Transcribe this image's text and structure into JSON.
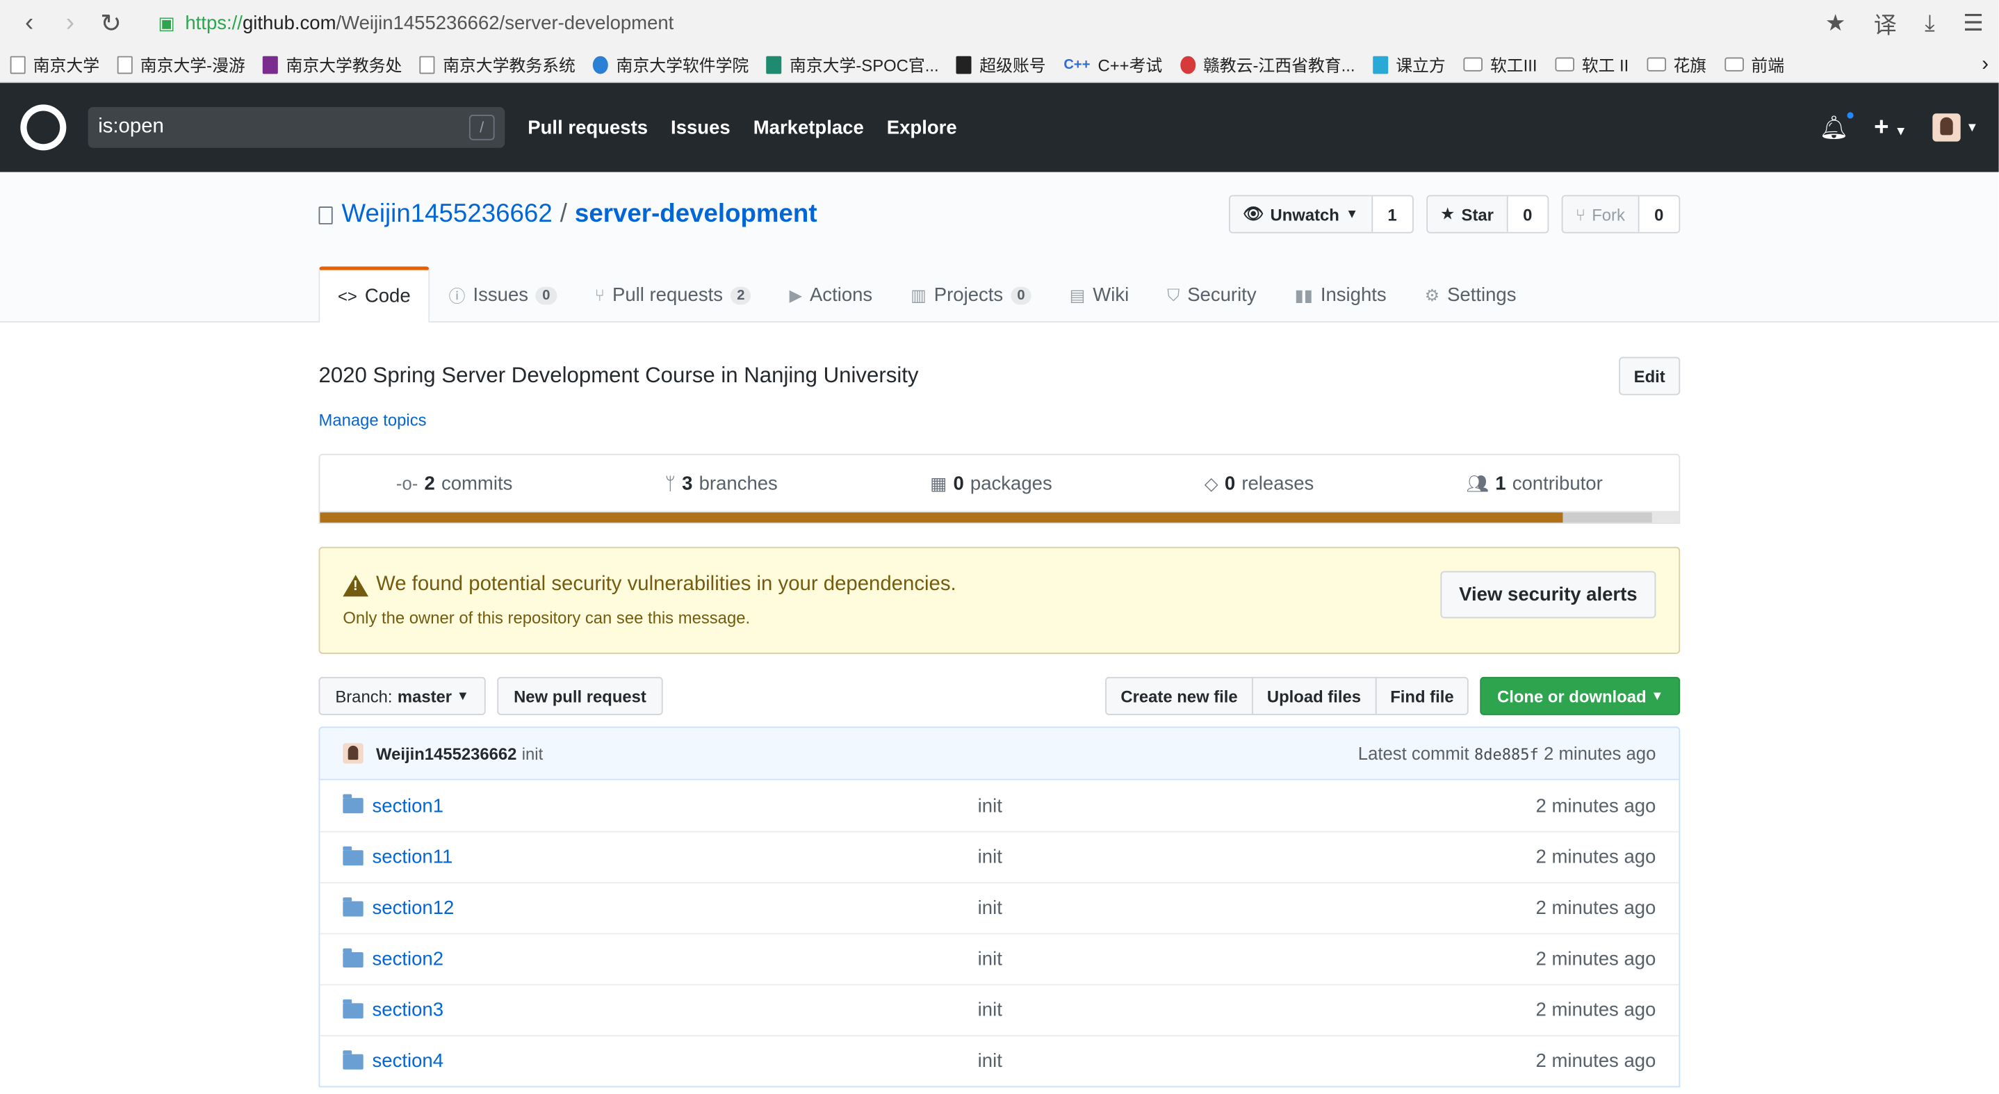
{
  "browser": {
    "url_scheme": "https://",
    "url_host": "github.com",
    "url_path": "/Weijin1455236662/server-development",
    "bookmarks": [
      {
        "label": "南京大学",
        "icon": "page"
      },
      {
        "label": "南京大学-漫游",
        "icon": "page"
      },
      {
        "label": "南京大学教务处",
        "icon": "seal"
      },
      {
        "label": "南京大学教务系统",
        "icon": "page"
      },
      {
        "label": "南京大学软件学院",
        "icon": "globe"
      },
      {
        "label": "南京大学-SPOC官...",
        "icon": "book"
      },
      {
        "label": "超级账号",
        "icon": "horse"
      },
      {
        "label": "C++考试",
        "icon": "cpp"
      },
      {
        "label": "赣教云-江西省教育...",
        "icon": "flag"
      },
      {
        "label": "课立方",
        "icon": "cube"
      },
      {
        "label": "软工III",
        "icon": "folder"
      },
      {
        "label": "软工 II",
        "icon": "folder"
      },
      {
        "label": "花旗",
        "icon": "folder"
      },
      {
        "label": "前端",
        "icon": "folder"
      }
    ]
  },
  "header": {
    "search_value": "is:open",
    "search_shortcut": "/",
    "nav": [
      "Pull requests",
      "Issues",
      "Marketplace",
      "Explore"
    ]
  },
  "repo": {
    "owner": "Weijin1455236662",
    "sep": "/",
    "name": "server-development",
    "watch_label": "Unwatch",
    "watch_count": "1",
    "star_label": "Star",
    "star_count": "0",
    "fork_label": "Fork",
    "fork_count": "0",
    "tabs": [
      {
        "label": "Code",
        "count": "",
        "icon": "code-icon"
      },
      {
        "label": "Issues",
        "count": "0",
        "icon": "issue-icon"
      },
      {
        "label": "Pull requests",
        "count": "2",
        "icon": "pull-request-icon"
      },
      {
        "label": "Actions",
        "count": "",
        "icon": "play-icon"
      },
      {
        "label": "Projects",
        "count": "0",
        "icon": "project-icon"
      },
      {
        "label": "Wiki",
        "count": "",
        "icon": "book-icon"
      },
      {
        "label": "Security",
        "count": "",
        "icon": "shield-icon"
      },
      {
        "label": "Insights",
        "count": "",
        "icon": "graph-icon"
      },
      {
        "label": "Settings",
        "count": "",
        "icon": "gear-icon"
      }
    ]
  },
  "main": {
    "description": "2020 Spring Server Development Course in Nanjing University",
    "edit_label": "Edit",
    "manage_topics": "Manage topics",
    "summary": {
      "commits_num": "2",
      "commits_label": "commits",
      "branches_num": "3",
      "branches_label": "branches",
      "packages_num": "0",
      "packages_label": "packages",
      "releases_num": "0",
      "releases_label": "releases",
      "contributors_num": "1",
      "contributors_label": "contributor"
    },
    "language_bar": [
      {
        "color": "#b07219",
        "percent": 91.5
      },
      {
        "color": "#cccccc",
        "percent": 6.5
      },
      {
        "color": "#e6e6e6",
        "percent": 2.0
      }
    ],
    "flash": {
      "title": "We found potential security vulnerabilities in your dependencies.",
      "subtitle": "Only the owner of this repository can see this message.",
      "button": "View security alerts"
    },
    "branch_label": "Branch:",
    "branch_name": "master",
    "new_pr": "New pull request",
    "create_file": "Create new file",
    "upload_files": "Upload files",
    "find_file": "Find file",
    "clone": "Clone or download",
    "commit": {
      "author": "Weijin1455236662",
      "message": "init",
      "latest_label": "Latest commit",
      "sha": "8de885f",
      "age": "2 minutes ago"
    },
    "files": [
      {
        "name": "section1",
        "message": "init",
        "age": "2 minutes ago"
      },
      {
        "name": "section11",
        "message": "init",
        "age": "2 minutes ago"
      },
      {
        "name": "section12",
        "message": "init",
        "age": "2 minutes ago"
      },
      {
        "name": "section2",
        "message": "init",
        "age": "2 minutes ago"
      },
      {
        "name": "section3",
        "message": "init",
        "age": "2 minutes ago"
      },
      {
        "name": "section4",
        "message": "init",
        "age": "2 minutes ago"
      }
    ]
  }
}
